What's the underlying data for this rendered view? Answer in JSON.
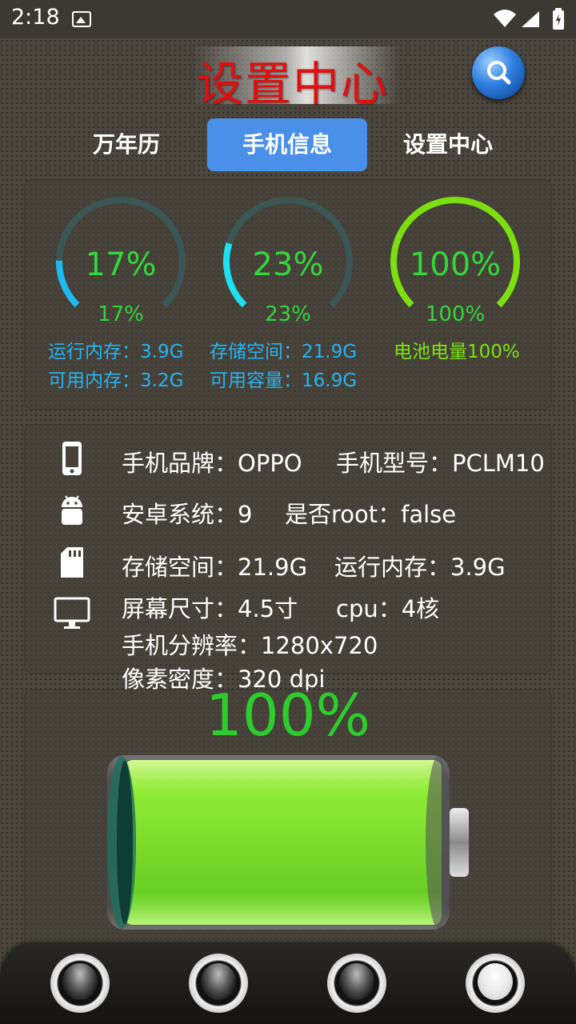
{
  "status_bar": {
    "time": "2:18"
  },
  "header": {
    "title": "设置中心"
  },
  "tabs": [
    {
      "label": "万年历",
      "active": false
    },
    {
      "label": "手机信息",
      "active": true
    },
    {
      "label": "设置中心",
      "active": false
    }
  ],
  "gauges": [
    {
      "percent": 17,
      "center_text": "17%",
      "sub_text": "17%",
      "color": "#1fb9f0"
    },
    {
      "percent": 23,
      "center_text": "23%",
      "sub_text": "23%",
      "color": "#1fe0f0"
    },
    {
      "percent": 100,
      "center_text": "100%",
      "sub_text": "100%",
      "color": "#7ddf10"
    }
  ],
  "memory": {
    "ram_line": "运行内存：3.9G",
    "ram_free_line": "可用内存：3.2G",
    "storage_line": "存储空间：21.9G",
    "storage_free_line": "可用容量：16.9G",
    "battery_line": "电池电量100%"
  },
  "phone_info": {
    "brand": "手机品牌：OPPO",
    "model": "手机型号：PCLM10",
    "android": "安卓系统：9",
    "root": "是否root：false",
    "storage": "存储空间：21.9G",
    "ram": "运行内存：3.9G",
    "screen_size": "屏幕尺寸：4.5寸",
    "cpu": "cpu：4核",
    "resolution": "手机分辨率：1280x720",
    "density": "像素密度：320 dpi"
  },
  "battery": {
    "percent_text": "100%",
    "level": 1.0,
    "fill_color": "#72ee10"
  },
  "colors": {
    "tab_active": "#4a90e8",
    "title": "#e01010",
    "percent_green": "#34d63b",
    "memory_blue": "#27b4f0"
  }
}
